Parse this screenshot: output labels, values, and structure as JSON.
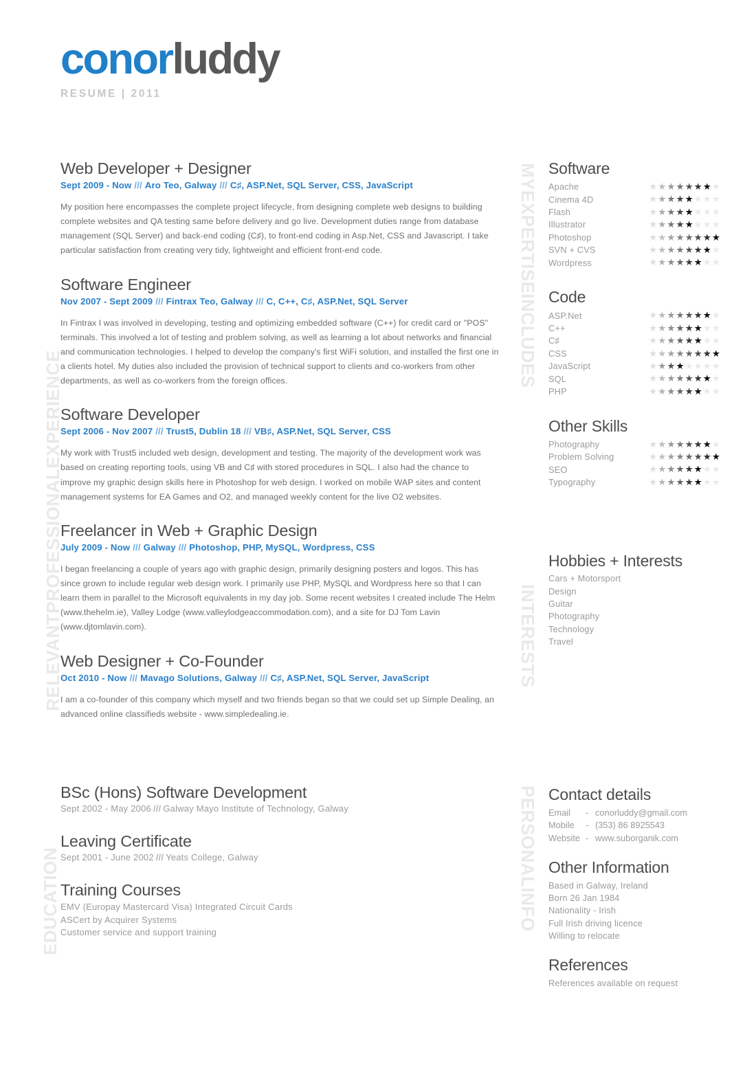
{
  "header": {
    "name_first": "conor",
    "name_last": "luddy",
    "subtitle": "RESUME | 2011"
  },
  "side_labels": {
    "experience": "RELEVANTPROFESSIONALEXPERIENCE",
    "education": "EDUCATION",
    "expertise": "MYEXPERTISEINCLUDES",
    "interests": "INTERESTS",
    "personal": "PERSONALINFO"
  },
  "experience": [
    {
      "title": "Web Developer + Designer",
      "dates": "Sept 2009 - Now",
      "company": "Aro Teo, Galway",
      "tech": "C♯, ASP.Net, SQL Server, CSS, JavaScript",
      "description": "My position here encompasses the complete project lifecycle, from designing complete web designs to building complete websites and QA testing same before delivery and go live. Development duties range from database management (SQL Server) and back-end coding (C♯), to front-end coding in Asp.Net, CSS and Javascript. I take particular satisfaction from creating very tidy, lightweight and efficient front-end code."
    },
    {
      "title": "Software Engineer",
      "dates": "Nov 2007 - Sept 2009",
      "company": "Fintrax Teo, Galway",
      "tech": "C, C++, C♯, ASP.Net, SQL Server",
      "description": "In Fintrax I was involved in developing, testing and optimizing embedded software (C++) for credit card or \"POS\" terminals. This involved a lot of testing and problem solving, as well as learning a lot about networks and financial and communication technologies. I helped to develop the company's first WiFi solution, and installed the first one in a clients hotel. My duties also included the provision of technical support to clients and co-workers from other departments, as well as co-workers from the foreign offices."
    },
    {
      "title": "Software Developer",
      "dates": "Sept 2006 - Nov 2007",
      "company": "Trust5, Dublin 18",
      "tech": "VB♯, ASP.Net, SQL Server, CSS",
      "description": "My work with Trust5 included web design, development and testing. The majority of the development work was based on creating reporting tools, using VB and C♯ with stored procedures in SQL. I also had the chance to improve my graphic design skills here in Photoshop for web design. I worked on mobile WAP sites and content management systems for EA Games and O2, and managed weekly content for the live O2 websites."
    },
    {
      "title": "Freelancer in Web + Graphic Design",
      "dates": "July 2009 - Now",
      "company": "Galway",
      "tech": "Photoshop, PHP, MySQL, Wordpress, CSS",
      "description": "I began freelancing a couple of years ago with graphic design, primarily designing posters and logos. This has since grown to include regular web design work. I primarily use PHP, MySQL and Wordpress here so that I can learn them in parallel to the Microsoft equivalents in my day job. Some recent websites I created include The Helm (www.thehelm.ie), Valley Lodge (www.valleylodgeaccommodation.com), and a site for DJ Tom Lavin (www.djtomlavin.com)."
    },
    {
      "title": "Web Designer + Co-Founder",
      "dates": "Oct 2010 - Now",
      "company": "Mavago Solutions, Galway",
      "tech": "C♯, ASP.Net, SQL Server, JavaScript",
      "description": "I am a co-founder of this company which myself and two friends began so that we could set up Simple Dealing, an advanced online classifieds website - www.simpledealing.ie."
    }
  ],
  "education": [
    {
      "title": "BSc (Hons) Software Development",
      "dates": "Sept 2002 - May 2006",
      "institution": "Galway Mayo Institute of Technology, Galway",
      "items": []
    },
    {
      "title": "Leaving Certificate",
      "dates": "Sept 2001 - June 2002",
      "institution": "Yeats College, Galway",
      "items": []
    },
    {
      "title": "Training Courses",
      "dates": "",
      "institution": "",
      "items": [
        "EMV (Europay Mastercard Visa) Integrated Circuit Cards",
        "ASCert by Acquirer Systems",
        "Customer service and support training"
      ]
    }
  ],
  "skills": {
    "max_stars": 8,
    "groups": [
      {
        "heading": "Software",
        "items": [
          {
            "name": "Apache",
            "rating": 7
          },
          {
            "name": "Cinema 4D",
            "rating": 5
          },
          {
            "name": "Flash",
            "rating": 5
          },
          {
            "name": "Illustrator",
            "rating": 5
          },
          {
            "name": "Photoshop",
            "rating": 8
          },
          {
            "name": "SVN + CVS",
            "rating": 7
          },
          {
            "name": "Wordpress",
            "rating": 6
          }
        ]
      },
      {
        "heading": "Code",
        "items": [
          {
            "name": "ASP.Net",
            "rating": 7
          },
          {
            "name": "C++",
            "rating": 6
          },
          {
            "name": "C♯",
            "rating": 6
          },
          {
            "name": "CSS",
            "rating": 8
          },
          {
            "name": "JavaScript",
            "rating": 4
          },
          {
            "name": "SQL",
            "rating": 7
          },
          {
            "name": "PHP",
            "rating": 6
          }
        ]
      },
      {
        "heading": "Other Skills",
        "items": [
          {
            "name": "Photography",
            "rating": 7
          },
          {
            "name": "Problem Solving",
            "rating": 8
          },
          {
            "name": "SEO",
            "rating": 6
          },
          {
            "name": "Typography",
            "rating": 6
          }
        ]
      }
    ]
  },
  "hobbies": {
    "heading": "Hobbies + Interests",
    "items": [
      "Cars + Motorsport",
      "Design",
      "Guitar",
      "Photography",
      "Technology",
      "Travel"
    ]
  },
  "contact": {
    "heading": "Contact details",
    "rows": [
      {
        "label": "Email",
        "dash": "-",
        "value": "conorluddy@gmail.com"
      },
      {
        "label": "Mobile",
        "dash": "-",
        "value": "(353) 86 8925543"
      },
      {
        "label": "Website",
        "dash": "-",
        "value": "www.suborganik.com"
      }
    ]
  },
  "other_information": {
    "heading": "Other Information",
    "items": [
      "Based in Galway, Ireland",
      "Born 26 Jan 1984",
      "Nationality - Irish",
      "Full Irish driving licence",
      "Willing to relocate"
    ]
  },
  "references": {
    "heading": "References",
    "text": "References available on request"
  },
  "colors": {
    "accent_blue": "#2a7fc9",
    "logo_blue": "#2080c8",
    "logo_gray": "#58585a",
    "heading_gray": "#4d4d4f",
    "body_gray": "#6d6e71",
    "muted_gray": "#9a9b9d",
    "side_label_gray": "#e9e9e9",
    "star_empty": "#eaeaea",
    "star_full": "#1a1a1a"
  },
  "separator": "///"
}
